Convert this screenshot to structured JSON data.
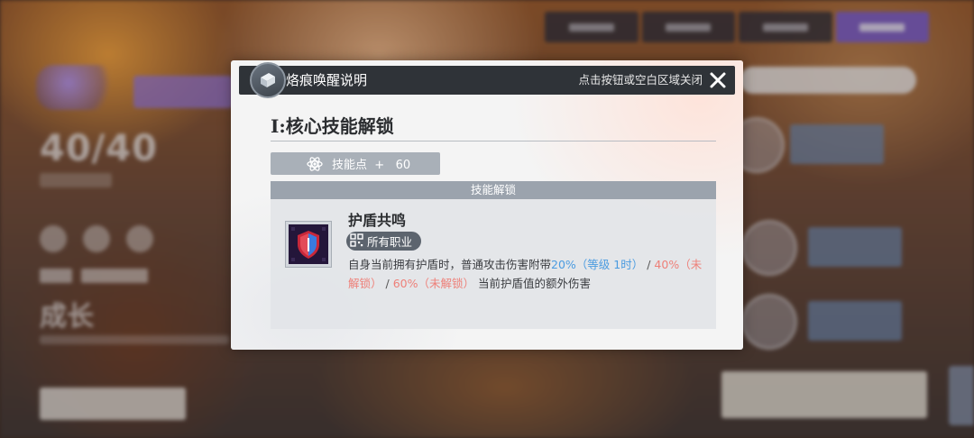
{
  "modal": {
    "title": "烙痕唤醒说明",
    "close_hint": "点击按钮或空白区域关闭",
    "section_title": "I:核心技能解锁",
    "points": {
      "label": "技能点",
      "plus": "+",
      "value": "60"
    },
    "unlock_header": "技能解锁",
    "skill": {
      "name": "护盾共鸣",
      "job_tag": "所有职业",
      "desc": {
        "prefix": "自身当前拥有护盾时，普通攻击伤害附带",
        "tier1": "20%（等级 1时）",
        "sep1": "/",
        "tier2": "40%（未解锁）",
        "sep2": "/",
        "tier3": "60%（未解锁）",
        "suffix": "当前护盾值的额外伤害"
      }
    }
  },
  "background": {
    "level_display": "40/40",
    "growth_label": "成长"
  },
  "colors": {
    "header_bg": "#2f3338",
    "tag_bg": "#a9b0b8",
    "unlock_header_bg": "#9ba3ad",
    "unlocked_value": "#4a9be0",
    "locked_value": "#ee8079",
    "active_tab": "#7e5fc6"
  },
  "icons": {
    "header_badge": "brand-badge-icon",
    "close": "close-icon",
    "points": "atom-icon",
    "job": "qr-grid-icon",
    "skill": "shield-resonance-icon"
  }
}
